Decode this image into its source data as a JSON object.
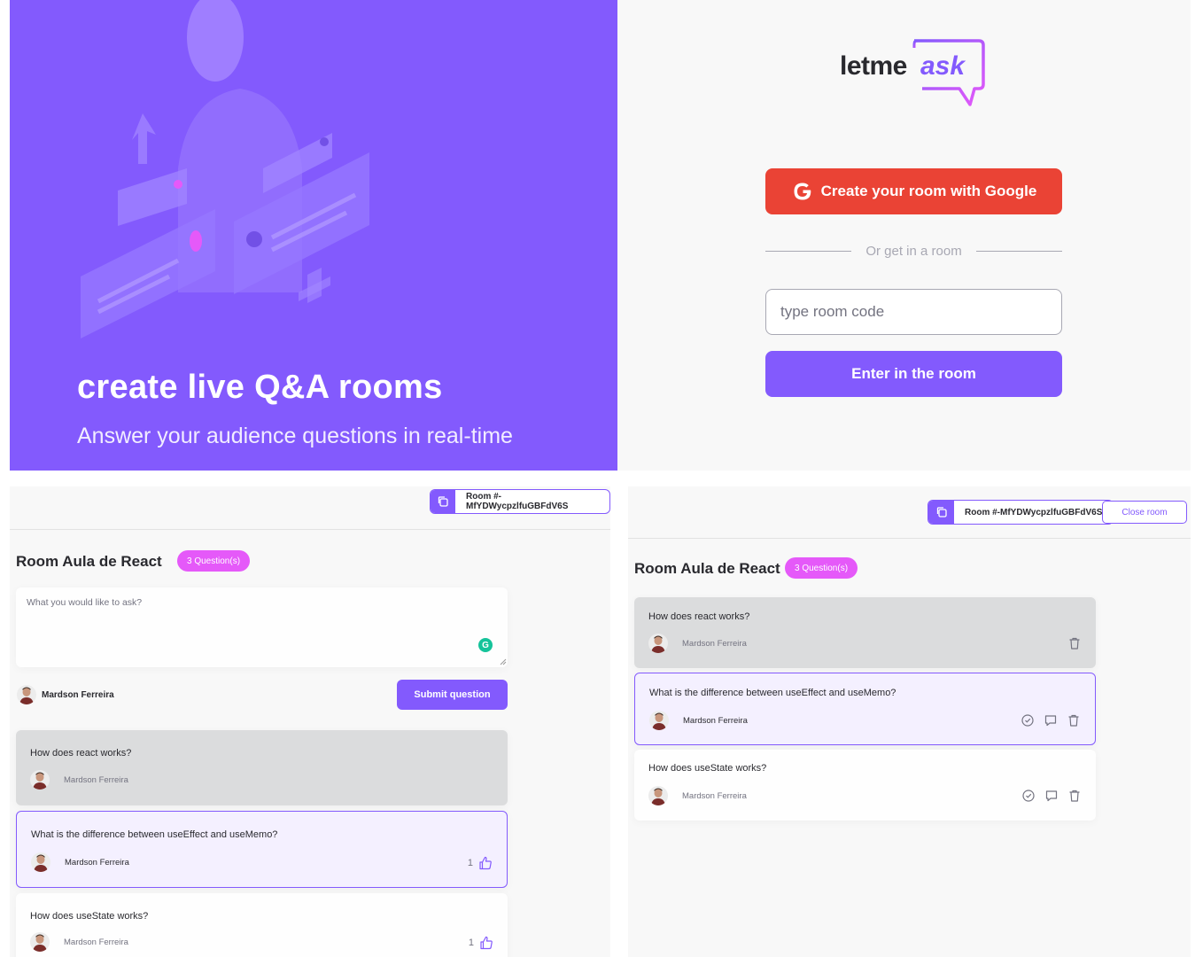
{
  "hero": {
    "title": "create live Q&A rooms",
    "subtitle": "Answer your audience questions in real-time"
  },
  "auth": {
    "logo_left": "letme",
    "logo_right": "ask",
    "google_button": "Create your room with Google",
    "divider": "Or get in a room",
    "room_placeholder": "type room code",
    "enter_button": "Enter in the room"
  },
  "user_room": {
    "room_code": "Room #-MfYDWycpzlfuGBFdV6S",
    "title": "Room Aula de React",
    "badge": "3 Question(s)",
    "ask_placeholder": "What you would like to ask?",
    "user_name": "Mardson Ferreira",
    "submit_button": "Submit question",
    "questions": [
      {
        "text": "How does react works?",
        "author": "Mardson Ferreira",
        "state": "answered"
      },
      {
        "text": "What is the difference between useEffect and useMemo?",
        "author": "Mardson Ferreira",
        "state": "highlighted",
        "likes": "1"
      },
      {
        "text": "How does useState works?",
        "author": "Mardson Ferreira",
        "state": "normal",
        "likes": "1"
      }
    ]
  },
  "admin_room": {
    "room_code": "Room #-MfYDWycpzlfuGBFdV6S",
    "close_button": "Close room",
    "title": "Room Aula de React",
    "badge": "3 Question(s)",
    "questions": [
      {
        "text": "How does react works?",
        "author": "Mardson Ferreira",
        "state": "answered"
      },
      {
        "text": "What is the difference between useEffect and useMemo?",
        "author": "Mardson Ferreira",
        "state": "highlighted"
      },
      {
        "text": "How does useState works?",
        "author": "Mardson Ferreira",
        "state": "normal"
      }
    ]
  },
  "colors": {
    "primary": "#835afd",
    "pink": "#e559f9",
    "google": "#ea4335",
    "background": "#f8f8f8",
    "text": "#29292e",
    "muted": "#737380"
  }
}
